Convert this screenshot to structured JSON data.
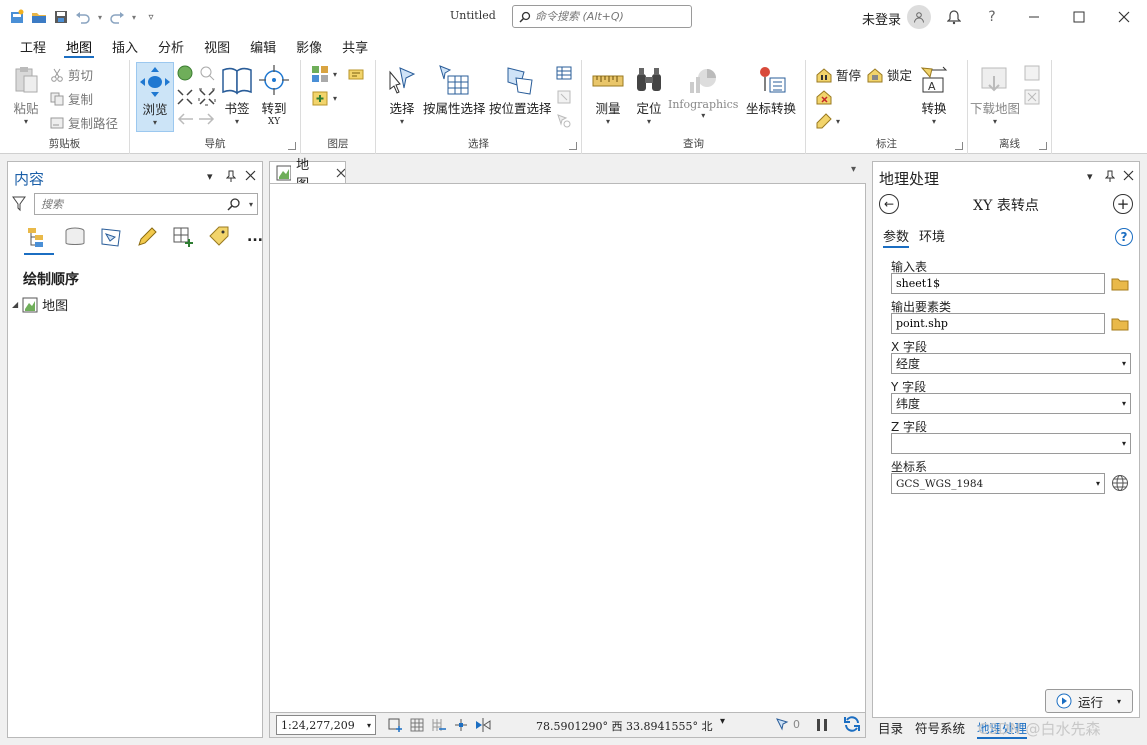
{
  "titlebar": {
    "doc_title": "Untitled",
    "search_placeholder": "命令搜索 (Alt+Q)",
    "user_label": "未登录",
    "help_label": "?"
  },
  "ribbon_tabs": [
    "工程",
    "地图",
    "插入",
    "分析",
    "视图",
    "编辑",
    "影像",
    "共享"
  ],
  "active_tab": "地图",
  "ribbon": {
    "clipboard": {
      "label": "剪贴板",
      "paste": "粘贴",
      "cut": "剪切",
      "copy": "复制",
      "copy_path": "复制路径"
    },
    "navigate": {
      "label": "导航",
      "explore": "浏览",
      "bookmarks": "书签",
      "goto": "转到",
      "goto_sub": "XY"
    },
    "layer": {
      "label": "图层"
    },
    "selection": {
      "label": "选择",
      "select": "选择",
      "by_attr": "按属性选择",
      "by_loc": "按位置选择"
    },
    "inquiry": {
      "label": "查询",
      "measure": "测量",
      "locate": "定位",
      "infographics": "Infographics",
      "coord_convert": "坐标转换"
    },
    "labeling": {
      "label": "标注",
      "pause": "暂停",
      "lock": "锁定",
      "convert": "转换"
    },
    "offline": {
      "label": "离线",
      "download": "下载地图"
    }
  },
  "contents_pane": {
    "title": "内容",
    "search_placeholder": "搜索",
    "more": "...",
    "draw_order": "绘制顺序",
    "map_item": "地图"
  },
  "map_view": {
    "tab_label": "地图",
    "scale": "1:24,277,209",
    "coordinates": "78.5901290° 西  33.8941555° 北",
    "selected_count": "0"
  },
  "geoprocessing": {
    "title": "地理处理",
    "tool_title": "XY 表转点",
    "tabs": [
      "参数",
      "环境"
    ],
    "active_tab": "参数",
    "params": {
      "input_table_label": "输入表",
      "input_table_value": "sheet1$",
      "output_label": "输出要素类",
      "output_value": "point.shp",
      "x_label": "X 字段",
      "x_value": "经度",
      "y_label": "Y 字段",
      "y_value": "纬度",
      "z_label": "Z 字段",
      "z_value": "",
      "cs_label": "坐标系",
      "cs_value": "GCS_WGS_1984"
    },
    "run_label": "运行"
  },
  "bottom_tabs": [
    "目录",
    "符号系统",
    "地理处理"
  ],
  "bottom_active": "地理处理",
  "watermark": "CSDN @白水先森",
  "colors": {
    "accent": "#1b6ec2",
    "highlight": "#cce4f7"
  }
}
